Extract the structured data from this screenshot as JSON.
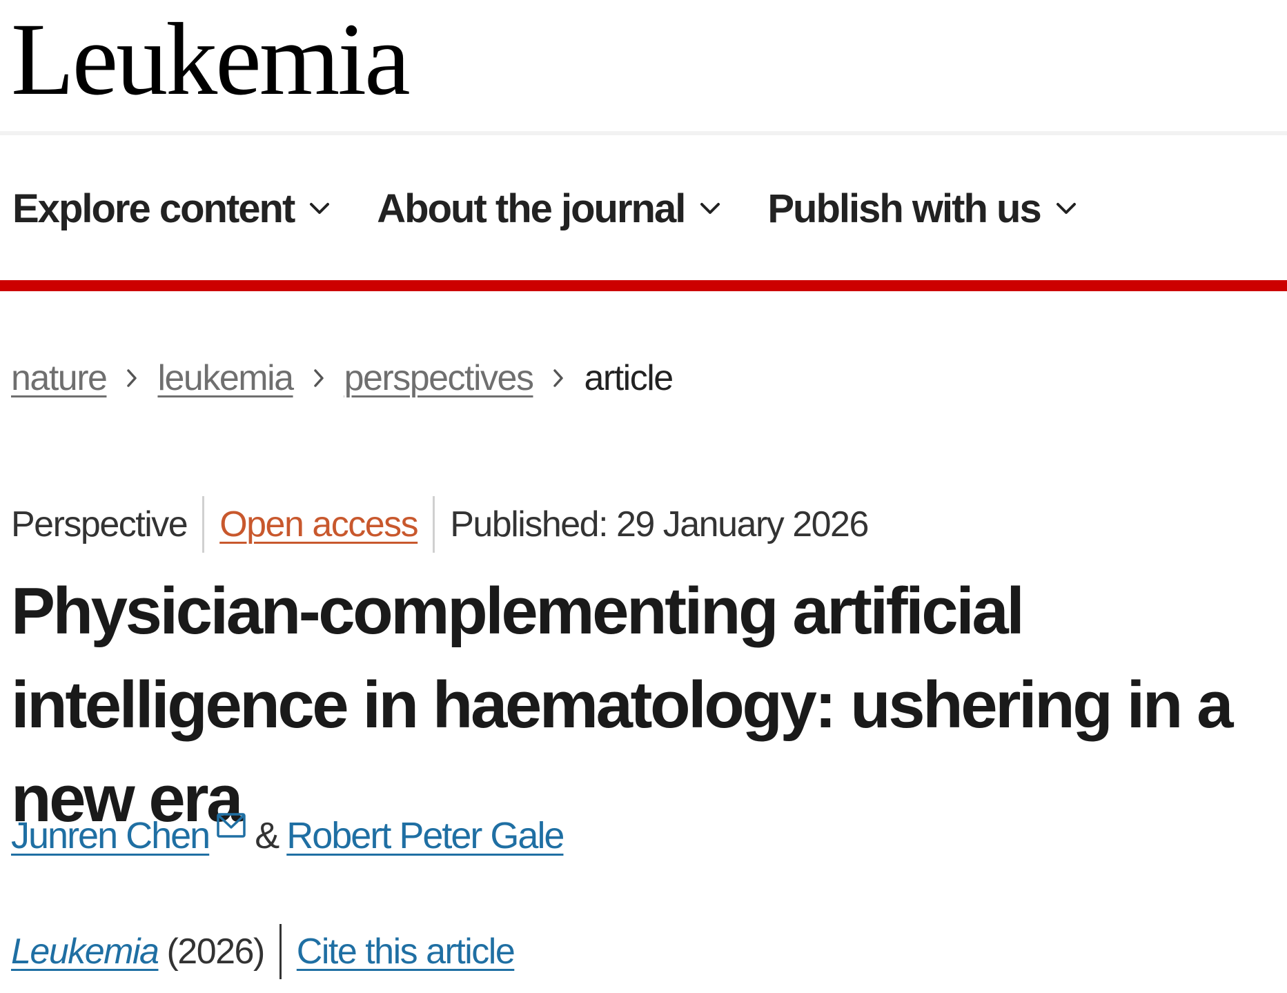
{
  "header": {
    "journal_name": "Leukemia"
  },
  "nav": {
    "items": [
      {
        "label": "Explore content",
        "icon": "chevron-down-icon"
      },
      {
        "label": "About the journal",
        "icon": "chevron-down-icon"
      },
      {
        "label": "Publish with us",
        "icon": "chevron-down-icon"
      }
    ]
  },
  "breadcrumb": {
    "items": [
      "nature",
      "leukemia",
      "perspectives",
      "article"
    ],
    "separator_icon": "chevron-right-icon"
  },
  "article": {
    "type": "Perspective",
    "access": "Open access",
    "published": "Published: 29 January 2026",
    "title": "Physician-complementing artificial intelligence in haematology: ushering in a new era",
    "authors": [
      {
        "name": "Junren Chen",
        "icon": "mail-icon"
      },
      {
        "name": "Robert Peter Gale"
      }
    ],
    "author_separator": "&",
    "citation": {
      "journal": "Leukemia",
      "year": "(2026)",
      "cite_label": "Cite this article"
    }
  },
  "colors": {
    "brand_red": "#cc0000",
    "link_blue": "#1f6fa3",
    "open_access_orange": "#c8582d",
    "breadcrumb_grey": "#6f6f6f"
  }
}
